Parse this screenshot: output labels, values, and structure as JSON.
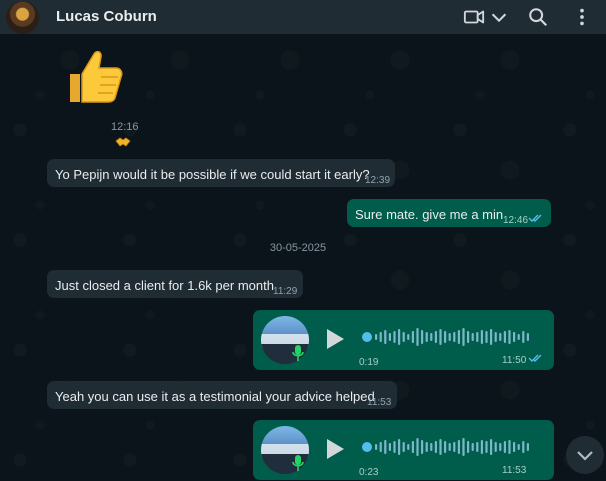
{
  "header": {
    "contact_name": "Lucas Coburn",
    "icons": [
      "video-call-icon",
      "chevron-down-icon",
      "search-icon",
      "menu-icon"
    ]
  },
  "sticker": {
    "emoji": "👍",
    "time": "12:16",
    "reaction": "🤝"
  },
  "messages": [
    {
      "dir": "in",
      "text": "Yo Pepijn would it be possible if we could start it early?",
      "time": "12:39"
    },
    {
      "dir": "out",
      "text": "Sure mate. give me a min",
      "time": "12:46"
    },
    {
      "dir": "in",
      "text": "Just closed a client for 1.6k per month",
      "time": "11:29"
    },
    {
      "dir": "in",
      "text": "Yeah you can use it as a testimonial your advice helped",
      "time": "11:53"
    }
  ],
  "date_divider": "30-05-2025",
  "voice_notes": [
    {
      "duration": "0:19",
      "time": "11:50"
    },
    {
      "duration": "0:23",
      "time": "11:53"
    }
  ],
  "colors": {
    "incoming": "#202c33",
    "outgoing": "#005c4b",
    "ticks": "#53bdeb",
    "bg": "#0b141a"
  }
}
